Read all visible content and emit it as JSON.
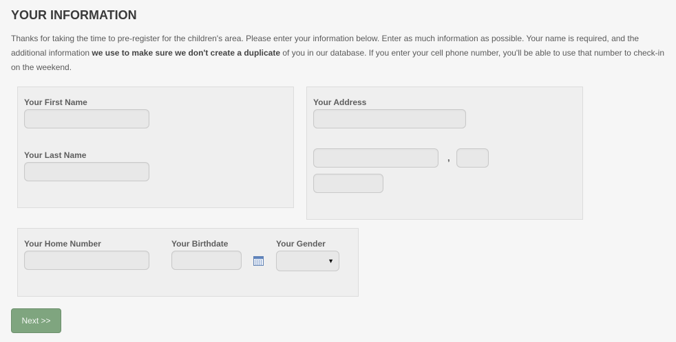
{
  "page": {
    "title": "YOUR INFORMATION"
  },
  "intro": {
    "part1": "Thanks for taking the time to pre-register for the children's area. Please enter your information below. Enter as much information as possible. Your name is required, and the additional information ",
    "bold": "we use to make sure we don't create a duplicate",
    "part2": " of you in our database. If you enter your cell phone number, you'll be able to use that number to check-in on the weekend."
  },
  "name_panel": {
    "first_name_label": "Your First Name",
    "first_name_value": "",
    "last_name_label": "Your Last Name",
    "last_name_value": ""
  },
  "address_panel": {
    "address_label": "Your Address",
    "street_value": "",
    "city_value": "",
    "separator": ",",
    "state_value": "",
    "zip_value": ""
  },
  "details_panel": {
    "home_number_label": "Your Home Number",
    "home_number_value": "",
    "birthdate_label": "Your Birthdate",
    "birthdate_value": "",
    "calendar_icon": "calendar-icon",
    "gender_label": "Your Gender",
    "gender_selected": "",
    "gender_arrow": "▼"
  },
  "actions": {
    "next_label": "Next >>"
  },
  "colors": {
    "next_button": "#7fa57f",
    "panel_bg": "#efefef",
    "page_bg": "#f6f6f6"
  }
}
